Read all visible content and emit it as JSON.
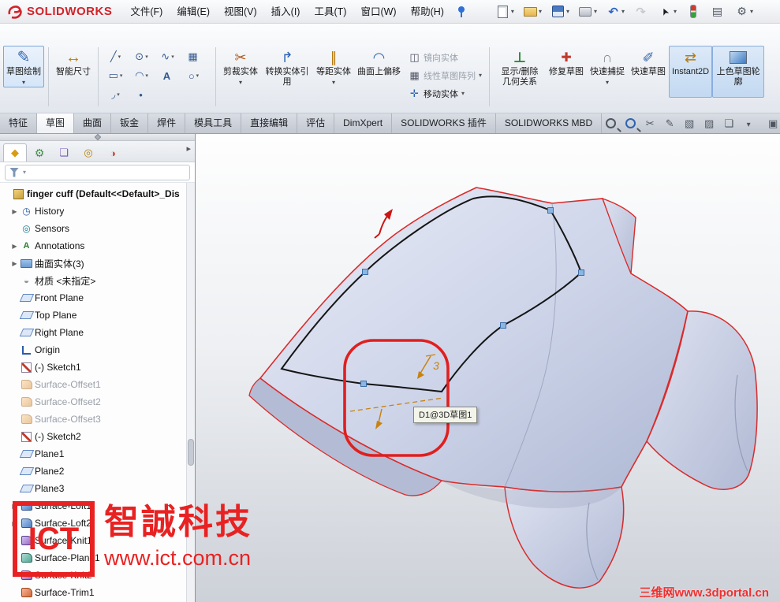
{
  "titlebar": {
    "logo": "SOLIDWORKS",
    "menus": [
      {
        "label": "文件(F)"
      },
      {
        "label": "编辑(E)"
      },
      {
        "label": "视图(V)"
      },
      {
        "label": "插入(I)"
      },
      {
        "label": "工具(T)"
      },
      {
        "label": "窗口(W)"
      },
      {
        "label": "帮助(H)"
      }
    ],
    "quick_tools": [
      {
        "icon": "new-document-icon",
        "caret": "▾"
      },
      {
        "icon": "open-icon",
        "caret": "▾"
      },
      {
        "icon": "save-icon",
        "caret": "▾"
      },
      {
        "icon": "print-icon",
        "caret": "▾"
      },
      {
        "icon": "undo-icon",
        "caret": "▾"
      },
      {
        "icon": "redo-icon",
        "cls": "disabled"
      },
      {
        "icon": "select-cursor-icon",
        "caret": "▾"
      },
      {
        "icon": "status-lights-icon"
      },
      {
        "icon": "taskpane-icon"
      },
      {
        "icon": "options-gear-icon",
        "caret": "▾"
      }
    ]
  },
  "ribbon": {
    "sketch_button": {
      "label": "草图绘制",
      "caret": "▾"
    },
    "smart_dimension_button": {
      "label": "智能尺寸"
    },
    "sketch_tools": [
      {
        "icon": "line-icon",
        "caret": "▾"
      },
      {
        "icon": "circle-icon",
        "caret": "▾"
      },
      {
        "icon": "spline-icon",
        "caret": "▾"
      },
      {
        "icon": "pattern-grid-icon"
      },
      {
        "icon": "rectangle-icon",
        "caret": "▾"
      },
      {
        "icon": "arc-icon",
        "caret": "▾"
      },
      {
        "icon": "text-icon"
      },
      {
        "icon": "ellipse-icon",
        "caret": "▾"
      },
      {
        "icon": "fillet-icon",
        "caret": "▾"
      },
      {
        "icon": "point-icon"
      }
    ],
    "buttons": [
      {
        "label": "剪裁实体",
        "icon": "trim-entities-icon",
        "caret": "▾"
      },
      {
        "label": "转换实体引用",
        "icon": "convert-entities-icon"
      },
      {
        "label": "等距实体",
        "icon": "offset-entities-icon",
        "caret": "▾"
      },
      {
        "label": "曲面上偏移",
        "icon": "surface-offset-icon"
      }
    ],
    "stack_buttons": [
      {
        "label": "镜向实体",
        "icon": "mirror-entities-icon",
        "cls": "disabled"
      },
      {
        "label": "线性草图阵列",
        "icon": "linear-pattern-icon",
        "caret": "▾",
        "cls": "disabled"
      },
      {
        "label": "移动实体",
        "icon": "move-entities-icon",
        "caret": "▾"
      }
    ],
    "right_buttons": [
      {
        "label": "显示/删除几何关系",
        "icon": "display-relations-icon"
      },
      {
        "label": "修复草图",
        "icon": "repair-sketch-icon"
      },
      {
        "label": "快速捕捉",
        "icon": "quick-snaps-icon",
        "caret": "▾"
      },
      {
        "label": "快速草图",
        "icon": "rapid-sketch-icon"
      },
      {
        "label": "Instant2D",
        "icon": "instant2d-icon",
        "cls": "pressed"
      },
      {
        "label": "上色草图轮廓",
        "icon": "shaded-contours-icon",
        "cls": "pressed"
      }
    ]
  },
  "tabs": [
    {
      "label": "特征"
    },
    {
      "label": "草图",
      "cls": "active"
    },
    {
      "label": "曲面"
    },
    {
      "label": "钣金"
    },
    {
      "label": "焊件"
    },
    {
      "label": "模具工具"
    },
    {
      "label": "直接编辑"
    },
    {
      "label": "评估"
    },
    {
      "label": "DimXpert"
    },
    {
      "label": "SOLIDWORKS 插件"
    },
    {
      "label": "SOLIDWORKS MBD"
    }
  ],
  "view_tools": [
    {
      "icon": "zoom-fit-icon"
    },
    {
      "icon": "zoom-area-icon"
    },
    {
      "icon": "section-icon"
    },
    {
      "icon": "annotation-pen-icon"
    },
    {
      "icon": "view-cube-icon"
    },
    {
      "icon": "appearance-icon"
    },
    {
      "icon": "panes-icon"
    },
    {
      "icon": "caret-down-icon"
    },
    {
      "icon": "expand-panel-icon"
    }
  ],
  "panel": {
    "tabs": [
      {
        "icon": "featuremanager-icon",
        "cls": "active"
      },
      {
        "icon": "propertymanager-icon"
      },
      {
        "icon": "configurationmanager-icon"
      },
      {
        "icon": "dimxpertmanager-icon"
      },
      {
        "icon": "displaymanager-icon"
      }
    ],
    "tree": {
      "root": {
        "label": "finger cuff (Default<<Default>_Dis",
        "icon": "part-icon"
      },
      "items": [
        {
          "label": "History",
          "icon": "history-icon",
          "cls": "has-arrow"
        },
        {
          "label": "Sensors",
          "icon": "sensors-icon"
        },
        {
          "label": "Annotations",
          "icon": "annotations-icon",
          "cls": "has-arrow"
        },
        {
          "label": "曲面实体(3)",
          "icon": "surface-bodies-folder-icon",
          "cls": "has-arrow"
        },
        {
          "label": "材质 <未指定>",
          "icon": "material-icon"
        },
        {
          "label": "Front Plane",
          "icon": "plane-icon"
        },
        {
          "label": "Top Plane",
          "icon": "plane-icon"
        },
        {
          "label": "Right Plane",
          "icon": "plane-icon"
        },
        {
          "label": "Origin",
          "icon": "origin-icon"
        },
        {
          "label": "(-) Sketch1",
          "icon": "sketch-tree-icon"
        },
        {
          "label": "Surface-Offset1",
          "icon": "surface-offset-feature-icon",
          "cls": "grayed"
        },
        {
          "label": "Surface-Offset2",
          "icon": "surface-offset-feature-icon",
          "cls": "grayed"
        },
        {
          "label": "Surface-Offset3",
          "icon": "surface-offset-feature-icon",
          "cls": "grayed"
        },
        {
          "label": "(-) Sketch2",
          "icon": "sketch-tree-icon"
        },
        {
          "label": "Plane1",
          "icon": "plane-icon"
        },
        {
          "label": "Plane2",
          "icon": "plane-icon"
        },
        {
          "label": "Plane3",
          "icon": "plane-icon"
        },
        {
          "label": "Surface-Loft1",
          "icon": "surface-loft-icon",
          "cls": "has-arrow"
        },
        {
          "label": "Surface-Loft2",
          "icon": "surface-loft-icon",
          "cls": "has-arrow"
        },
        {
          "label": "Surface-Knit1",
          "icon": "surface-knit-icon"
        },
        {
          "label": "Surface-Plane1",
          "icon": "surface-plane-icon"
        },
        {
          "label": "Surface-Knit2",
          "icon": "surface-knit-icon"
        },
        {
          "label": "Surface-Trim1",
          "icon": "surface-trim-icon"
        }
      ]
    }
  },
  "viewport": {
    "tooltip": "D1@3D草图1",
    "dimension_value": "3",
    "colors": {
      "edge_red": "#d92b2b",
      "highlight_red": "#e01f1f",
      "dimension_orange": "#c8820f",
      "sketch_black": "#151515",
      "point_blue": "#8cb6e2",
      "surface_lavender": "#ccd3e8"
    }
  },
  "watermarks": {
    "ict_logo": "ICT",
    "ict_name": "智誠科技",
    "ict_url": "www.ict.com.cn",
    "portal": "三维网www.3dportal.cn"
  }
}
